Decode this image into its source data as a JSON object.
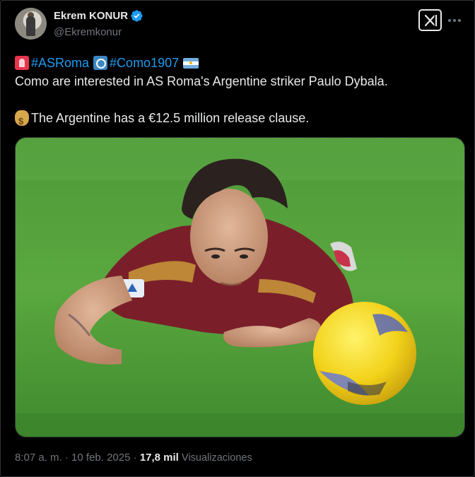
{
  "author": {
    "display_name": "Ekrem KONUR",
    "handle": "@Ekremkonur",
    "verified": true
  },
  "header": {
    "grok_icon": "grok-icon",
    "more_icon": "more-dots-icon"
  },
  "tweet": {
    "line1": {
      "hashtag1": "#ASRoma",
      "hashtag2": "#Como1907",
      "emoji": [
        "siren-emoji",
        "swap-arrows-emoji",
        "argentina-flag-emoji"
      ]
    },
    "line2": "Como are interested in AS Roma's Argentine striker Paulo Dybala.",
    "line3": "The Argentine has a €12.5 million release clause.",
    "line3_emoji": "money-bag-emoji"
  },
  "media": {
    "kind": "photo",
    "subject": "football-player-lying-on-pitch-with-ball"
  },
  "meta": {
    "time": "8:07 a. m.",
    "separator": " · ",
    "date": "10 feb. 2025",
    "views_count": "17,8 mil",
    "views_label": "Visualizaciones"
  },
  "colors": {
    "background": "#000000",
    "text": "#e7e9ea",
    "secondary": "#71767b",
    "accent": "#1d9bf0",
    "border": "#2f3336"
  }
}
